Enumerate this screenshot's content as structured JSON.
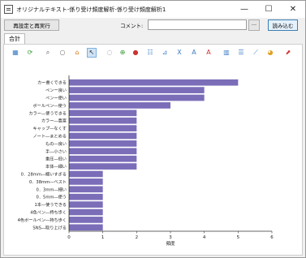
{
  "window": {
    "title": "オリジナルテキスト-係り受け頻度解析-係り受け頻度解析1",
    "minimize": "—",
    "maximize": "☐",
    "close": "✕"
  },
  "toolbar": {
    "reset_rerun_label": "再設定と再実行",
    "comment_label": "コメント:",
    "comment_value": "",
    "ellipsis_label": "···",
    "load_label": "読み込む"
  },
  "tabs": [
    {
      "label": "合計"
    }
  ],
  "icons": [
    {
      "name": "grid-icon",
      "glyph": "▦",
      "color": "#3b7dc4"
    },
    {
      "name": "refresh-icon",
      "glyph": "⟳",
      "color": "#3a9a3a"
    },
    {
      "name": "search-doc-icon",
      "glyph": "⌕",
      "color": "#555555"
    },
    {
      "name": "zoom-icon",
      "glyph": "○",
      "color": "#777777"
    },
    {
      "name": "home-icon",
      "glyph": "⌂",
      "color": "#d77a1a"
    },
    {
      "name": "pointer-icon",
      "glyph": "↖",
      "color": "#333333"
    },
    {
      "name": "lasso-icon",
      "glyph": "◌",
      "color": "#777777"
    },
    {
      "name": "add-icon",
      "glyph": "⊕",
      "color": "#3a9a3a"
    },
    {
      "name": "stop-icon",
      "glyph": "●",
      "color": "#cc3333"
    },
    {
      "name": "legend-icon",
      "glyph": "☷",
      "color": "#3b7dc4"
    },
    {
      "name": "axis-icon",
      "glyph": "⊿",
      "color": "#3b7dc4"
    },
    {
      "name": "xaxis-label-icon",
      "glyph": "X",
      "color": "#3b7dc4"
    },
    {
      "name": "yaxis-label-icon",
      "glyph": "A",
      "color": "#3b7dc4"
    },
    {
      "name": "font-icon",
      "glyph": "A",
      "color": "#cc3333"
    },
    {
      "name": "bar-chart-icon",
      "glyph": "▥",
      "color": "#3b7dc4"
    },
    {
      "name": "hbar-chart-icon",
      "glyph": "☰",
      "color": "#3b7dc4"
    },
    {
      "name": "line-chart-icon",
      "glyph": "⟋",
      "color": "#3b7dc4"
    },
    {
      "name": "pie-chart-icon",
      "glyph": "◕",
      "color": "#e0a020"
    },
    {
      "name": "export-icon",
      "glyph": "⬈",
      "color": "#cc3333"
    }
  ],
  "chart_data": {
    "type": "bar",
    "orientation": "horizontal",
    "categories": [
      "カー書くできる",
      "ペンー良い",
      "ペンー使い",
      "ボールペン―使う",
      "カラー―使うできる",
      "カラー―豊富",
      "キャップ―なくす",
      "ノート―まとめる",
      "もの―良い",
      "手―小さい",
      "重圧―低い",
      "本体―細い",
      "0．28mm―細いすぎる",
      "0．38mm―ベスト",
      "0．3mm―細い",
      "0．5mm―使う",
      "1本―使うできる",
      "4色ペン―持ち歩く",
      "4色ボールペン―持ち歩く",
      "SNS―取り上げる"
    ],
    "values": [
      5,
      4,
      4,
      3,
      2,
      2,
      2,
      2,
      2,
      2,
      2,
      2,
      1,
      1,
      1,
      1,
      1,
      1,
      1,
      1
    ],
    "xlabel": "頻度",
    "ylabel": "",
    "xlim": [
      0,
      6
    ],
    "xticks": [
      "0",
      "1",
      "2",
      "3",
      "4",
      "5",
      "6"
    ],
    "grid": false,
    "legend": "none",
    "bar_color": "#7b6db8"
  }
}
